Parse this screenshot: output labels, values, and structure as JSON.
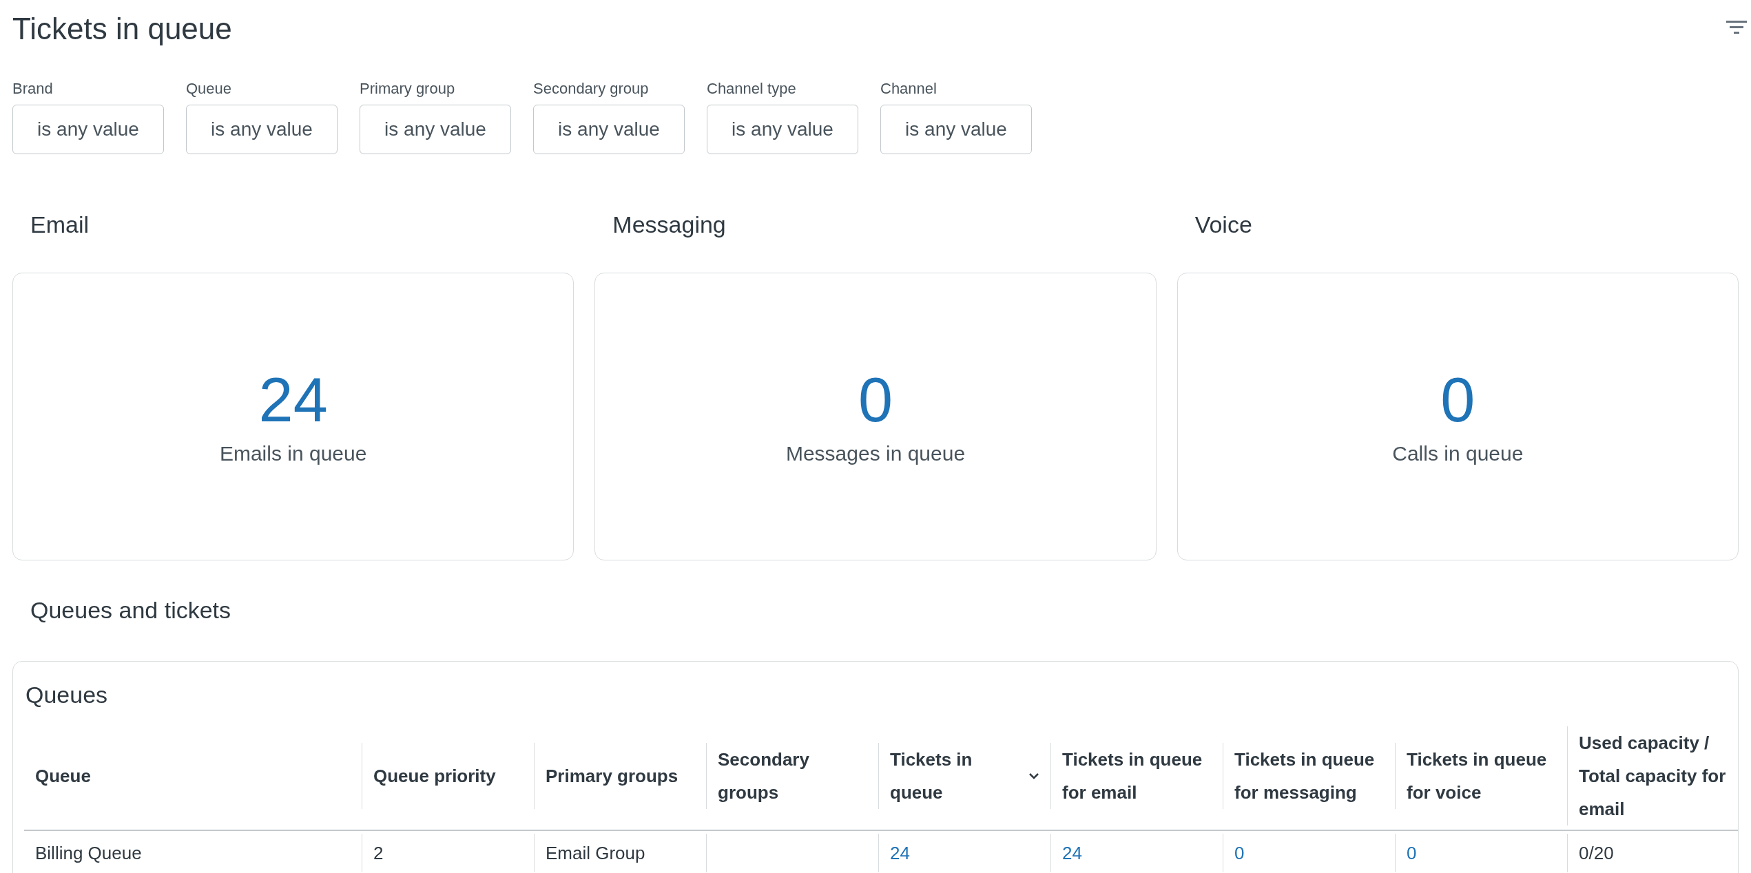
{
  "page_title": "Tickets in queue",
  "filters": [
    {
      "label": "Brand",
      "value": "is any value"
    },
    {
      "label": "Queue",
      "value": "is any value"
    },
    {
      "label": "Primary group",
      "value": "is any value"
    },
    {
      "label": "Secondary group",
      "value": "is any value"
    },
    {
      "label": "Channel type",
      "value": "is any value"
    },
    {
      "label": "Channel",
      "value": "is any value"
    }
  ],
  "channels": [
    {
      "heading": "Email",
      "count": "24",
      "caption": "Emails in queue"
    },
    {
      "heading": "Messaging",
      "count": "0",
      "caption": "Messages in queue"
    },
    {
      "heading": "Voice",
      "count": "0",
      "caption": "Calls in queue"
    }
  ],
  "section_title": "Queues and tickets",
  "table": {
    "title": "Queues",
    "columns": [
      {
        "label": "Queue",
        "sorted": false
      },
      {
        "label": "Queue priority",
        "sorted": false
      },
      {
        "label": "Primary groups",
        "sorted": false
      },
      {
        "label": "Secondary groups",
        "sorted": false
      },
      {
        "label": "Tickets in queue",
        "sorted": true
      },
      {
        "label": "Tickets in queue for email",
        "sorted": false
      },
      {
        "label": "Tickets in queue for messaging",
        "sorted": false
      },
      {
        "label": "Tickets in queue for voice",
        "sorted": false
      },
      {
        "label": "Used capacity / Total capacity for email",
        "sorted": false
      }
    ],
    "rows": [
      {
        "cells": [
          {
            "text": "Billing Queue",
            "link": false
          },
          {
            "text": "2",
            "link": false
          },
          {
            "text": "Email Group",
            "link": false
          },
          {},
          {
            "text": "24",
            "link": true
          },
          {
            "text": "24",
            "link": true
          },
          {
            "text": "0",
            "link": true
          },
          {
            "text": "0",
            "link": true
          },
          {
            "text": "0/20",
            "link": false
          }
        ]
      }
    ]
  }
}
